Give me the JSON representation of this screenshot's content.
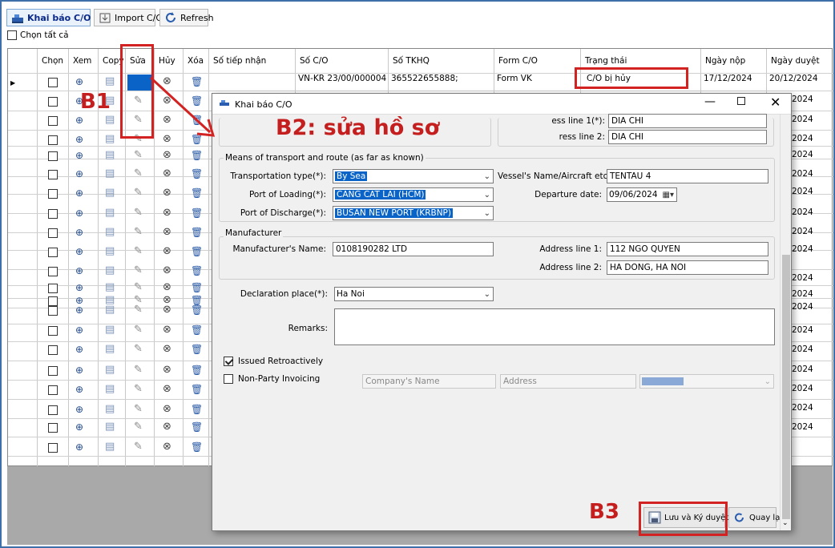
{
  "toolbar": {
    "declare_label": "Khai báo C/O",
    "import_label": "Import C/O",
    "refresh_label": "Refresh",
    "select_all_label": "Chọn tất cả"
  },
  "grid": {
    "headers": [
      "Chọn",
      "Xem",
      "Copy",
      "Sửa",
      "Hủy",
      "Xóa",
      "Số tiếp nhận",
      "Số C/O",
      "Số TKHQ",
      "Form C/O",
      "Trạng thái",
      "Ngày nộp",
      "Ngày duyệt"
    ],
    "first_row": {
      "so_co": "VN-KR 23/00/000004",
      "so_tkhq": "365522655888;",
      "form": "Form VK",
      "trang_thai": "C/O bị hủy",
      "ngay_nop": "17/12/2024",
      "ngay_duyet": "20/12/2024"
    },
    "right_dates": [
      "2024",
      "2024",
      "2024",
      "2024",
      "2024",
      "2024",
      "2024",
      "2024",
      "2024",
      "2024",
      "2024",
      "2024",
      "2024",
      "2024",
      "2024",
      "2024",
      "2024",
      "2024"
    ]
  },
  "dialog": {
    "title": "Khai báo C/O",
    "top_labels": {
      "addr1": "ess line 1(*):",
      "addr2": "ress line 2:"
    },
    "top_values": {
      "addr1": "DIA CHI",
      "addr2": "DIA CHI"
    },
    "transport": {
      "group_label": "Means of transport and route (as far as known)",
      "type_label": "Transportation type(*):",
      "type_value": "By Sea",
      "loading_label": "Port of Loading(*):",
      "loading_value": "CANG CAT LAI (HCM)",
      "discharge_label": "Port of Discharge(*):",
      "discharge_value": "BUSAN NEW PORT (KRBNP)",
      "vessel_label": "Vessel's Name/Aircraft etc(*):",
      "vessel_value": "TENTAU 4",
      "departure_label": "Departure date:",
      "departure_value": "09/06/2024"
    },
    "manufacturer": {
      "group_label": "Manufacturer",
      "name_label": "Manufacturer's Name:",
      "name_value": "0108190282 LTD",
      "addr1_label": "Address line 1:",
      "addr1_value": "112 NGO QUYEN",
      "addr2_label": "Address line 2:",
      "addr2_value": "HA DONG, HA NOI"
    },
    "declaration_place_label": "Declaration place(*):",
    "declaration_place_value": "Ha Noi",
    "remarks_label": "Remarks:",
    "issued_retro_label": "Issued Retroactively",
    "non_party_label": "Non-Party Invoicing",
    "company_placeholder": "Company's Name",
    "address_placeholder": "Address",
    "save_button": "Lưu và Ký duyệt",
    "back_button": "Quay lại"
  },
  "annotations": {
    "b1": "B1",
    "b2": "B2: sửa hồ sơ",
    "b3": "B3"
  },
  "colors": {
    "accent": "#0a64c8",
    "annotation": "#d32222"
  }
}
